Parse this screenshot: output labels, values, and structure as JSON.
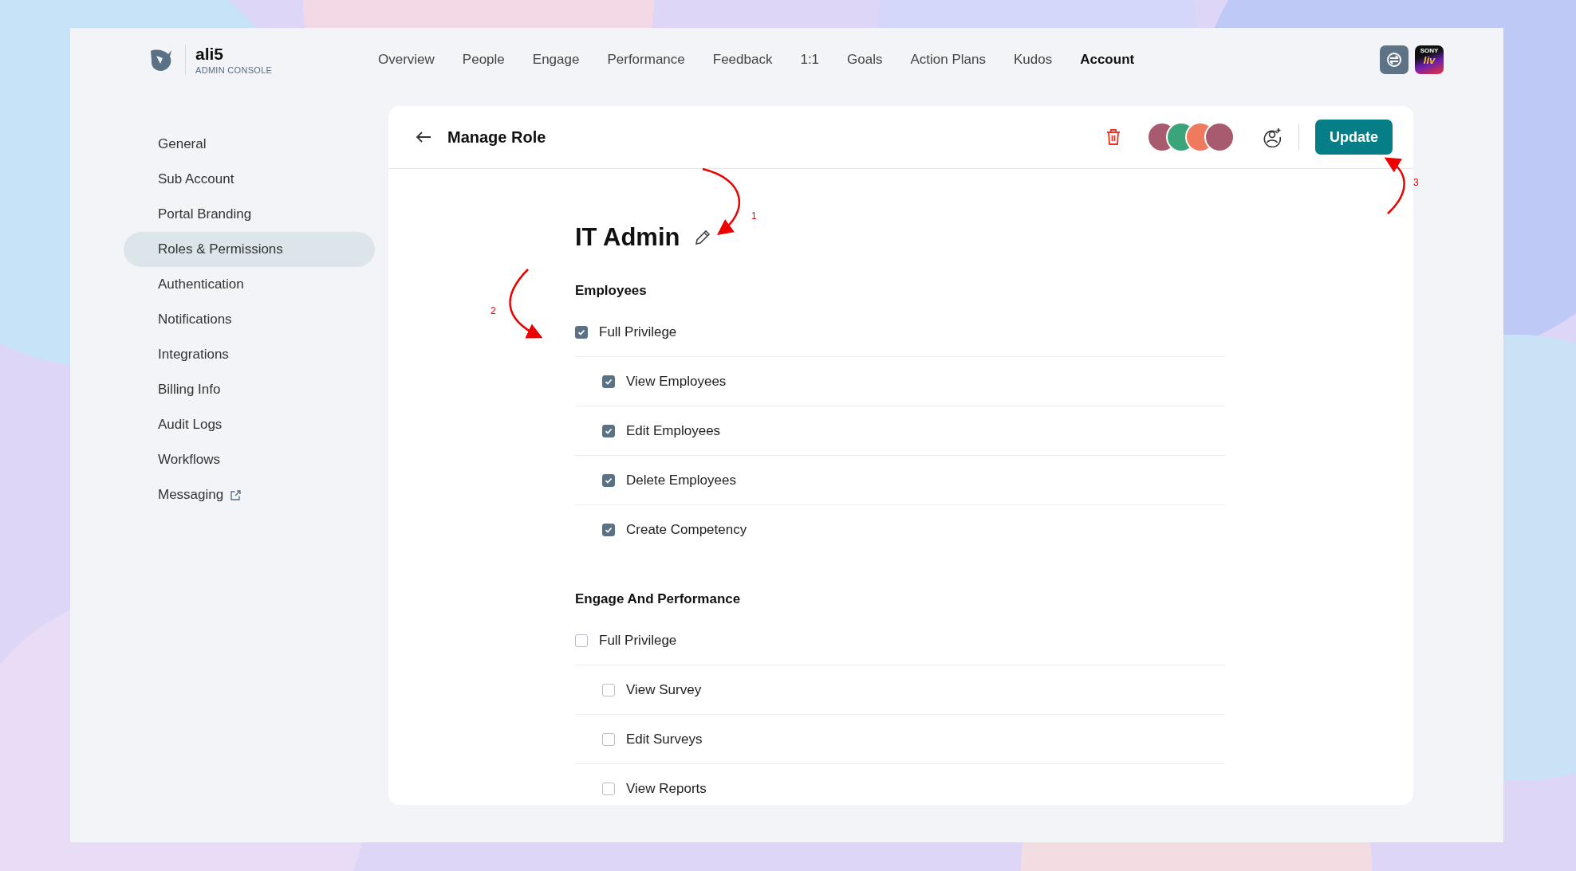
{
  "brand": {
    "name": "ali5",
    "subtitle": "ADMIN CONSOLE"
  },
  "nav": [
    {
      "label": "Overview",
      "selected": false
    },
    {
      "label": "People",
      "selected": false
    },
    {
      "label": "Engage",
      "selected": false
    },
    {
      "label": "Performance",
      "selected": false
    },
    {
      "label": "Feedback",
      "selected": false
    },
    {
      "label": "1:1",
      "selected": false
    },
    {
      "label": "Goals",
      "selected": false
    },
    {
      "label": "Action Plans",
      "selected": false
    },
    {
      "label": "Kudos",
      "selected": false
    },
    {
      "label": "Account",
      "selected": true
    }
  ],
  "app_badge": {
    "top": "SONY",
    "bottom": "liv"
  },
  "sidebar": {
    "items": [
      {
        "label": "General",
        "selected": false
      },
      {
        "label": "Sub Account",
        "selected": false
      },
      {
        "label": "Portal Branding",
        "selected": false
      },
      {
        "label": "Roles & Permissions",
        "selected": true
      },
      {
        "label": "Authentication",
        "selected": false
      },
      {
        "label": "Notifications",
        "selected": false
      },
      {
        "label": "Integrations",
        "selected": false
      },
      {
        "label": "Billing Info",
        "selected": false
      },
      {
        "label": "Audit Logs",
        "selected": false
      },
      {
        "label": "Workflows",
        "selected": false
      },
      {
        "label": "Messaging",
        "selected": false,
        "external": true
      }
    ]
  },
  "card": {
    "title": "Manage Role",
    "update_button": "Update",
    "avatars": [
      {
        "color": "#a85a6e"
      },
      {
        "color": "#3aa57a"
      },
      {
        "color": "#f07a5e"
      },
      {
        "color": "#a85a6e"
      }
    ],
    "role_name": "IT Admin",
    "sections": [
      {
        "title": "Employees",
        "full": {
          "label": "Full Privilege",
          "checked": true
        },
        "permissions": [
          {
            "label": "View Employees",
            "checked": true
          },
          {
            "label": "Edit Employees",
            "checked": true
          },
          {
            "label": "Delete Employees",
            "checked": true
          },
          {
            "label": "Create Competency",
            "checked": true
          }
        ]
      },
      {
        "title": "Engage And Performance",
        "full": {
          "label": "Full Privilege",
          "checked": false
        },
        "permissions": [
          {
            "label": "View Survey",
            "checked": false
          },
          {
            "label": "Edit Surveys",
            "checked": false
          },
          {
            "label": "View Reports",
            "checked": false
          }
        ]
      }
    ]
  },
  "annotations": [
    "1",
    "2",
    "3"
  ]
}
